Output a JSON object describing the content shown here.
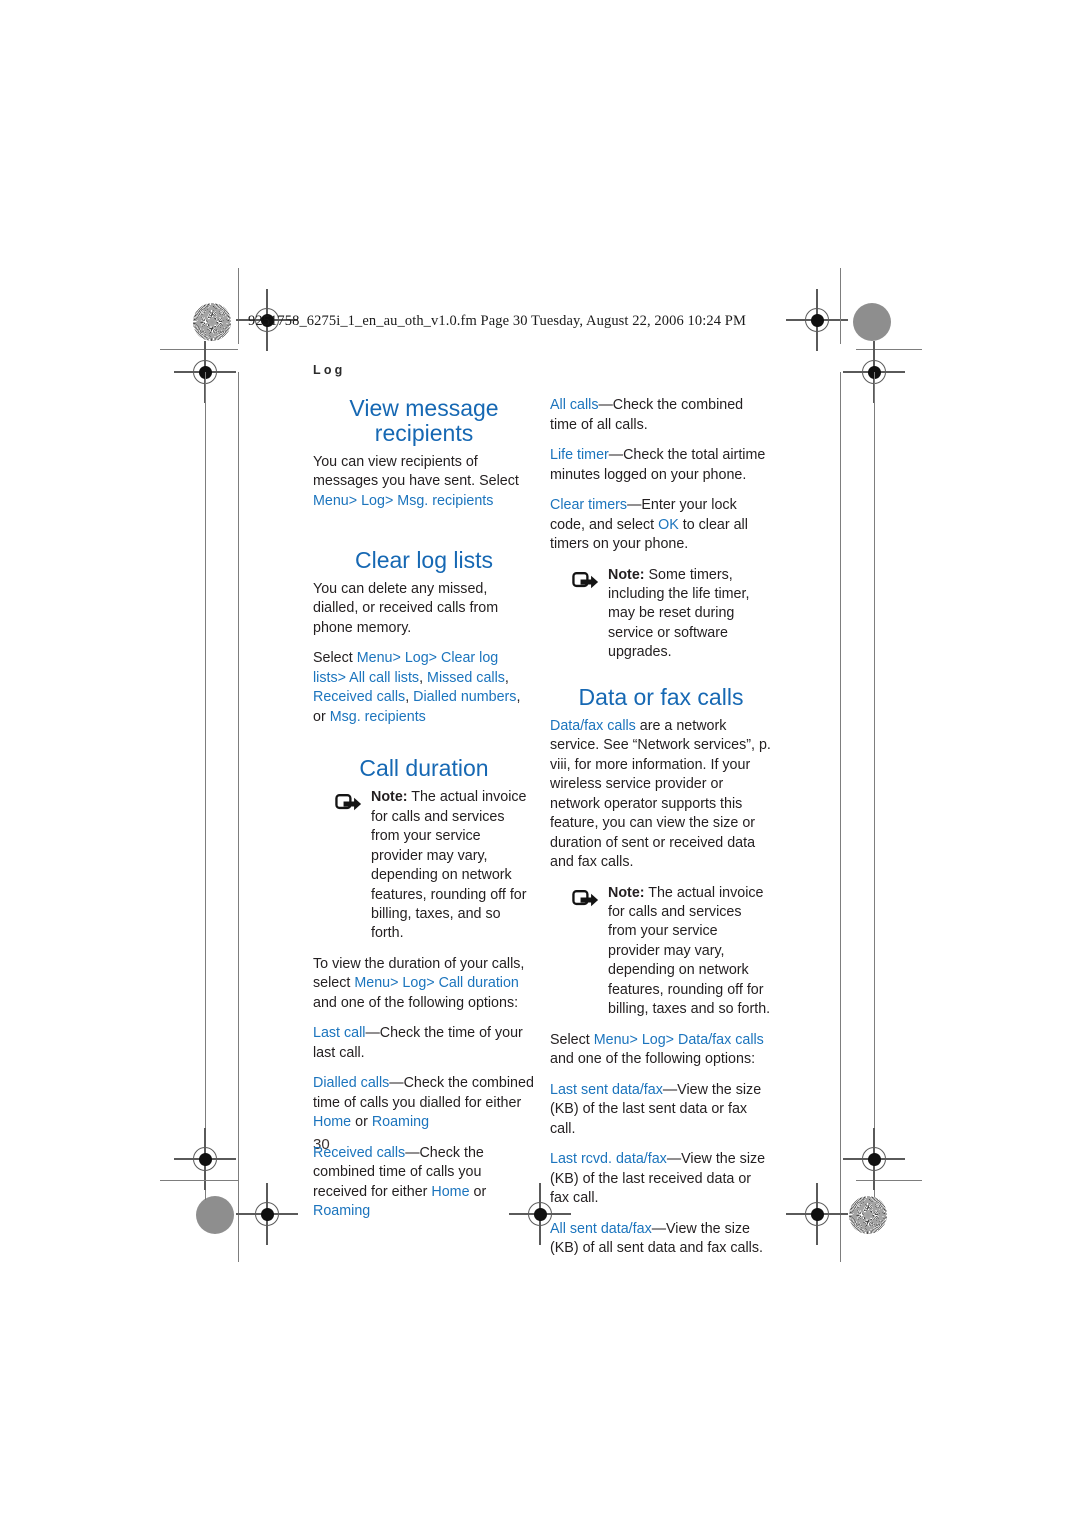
{
  "document": {
    "slugline": "9251758_6275i_1_en_au_oth_v1.0.fm  Page 30  Tuesday, August 22, 2006  10:24 PM",
    "running_head": "Log",
    "page_number": "30",
    "accent_color": "#1668b3",
    "link_color": "#1b74bd",
    "text_color": "#231f20"
  },
  "marks": {
    "starburst_top_left": "starburst-print-mark",
    "gray_circle_top_right": "gray-circle-print-mark",
    "gray_circle_bottom_left": "gray-circle-print-mark",
    "starburst_bottom_right": "starburst-print-mark"
  },
  "left_column": {
    "heading_view_message_recipients": "View message recipients",
    "p_view_1_a": "You can view recipients of messages you have sent. Select ",
    "p_view_1_menu": "Menu",
    "p_view_1_gt1": "> ",
    "p_view_1_log": "Log",
    "p_view_1_gt2": "> ",
    "p_view_1_msgrecip": "Msg. recipients",
    "heading_clear_log_lists": "Clear log lists",
    "p_clear_1": "You can delete any missed, dialled, or received calls from phone memory.",
    "p_clear_2_select": "Select ",
    "p_clear_2_menu": "Menu",
    "p_clear_2_gt1": "> ",
    "p_clear_2_log": "Log",
    "p_clear_2_gt2": "> ",
    "p_clear_2_clearloglists": "Clear log lists",
    "p_clear_2_gt3": "> ",
    "p_clear_2_allcalllists": "All call lists",
    "p_clear_2_c1": ", ",
    "p_clear_2_missedcalls": "Missed calls",
    "p_clear_2_c2": ", ",
    "p_clear_2_receivedcalls": "Received calls",
    "p_clear_2_c3": ", ",
    "p_clear_2_diallednumbers": "Dialled numbers",
    "p_clear_2_or": ", or ",
    "p_clear_2_msgrecipients": "Msg. recipients",
    "heading_call_duration": "Call duration",
    "note1_label": "Note:",
    "note1_text": " The actual invoice for calls and services from your service provider may vary, depending on network features, rounding off for billing, taxes, and so forth.",
    "p_dur_1_a": "To view the duration of your calls, select ",
    "p_dur_1_menu": "Menu",
    "p_dur_1_gt1": "> ",
    "p_dur_1_log": "Log",
    "p_dur_1_gt2": "> ",
    "p_dur_1_callduration": "Call duration",
    "p_dur_1_b": " and one of the following options:",
    "opt_lastcall_term": "Last call",
    "opt_lastcall_def": "—Check the time of your last call.",
    "opt_dialledcalls_term": "Dialled calls",
    "opt_dialledcalls_def_a": "—Check the combined time of calls you dialled for either ",
    "opt_dialledcalls_home": "Home",
    "opt_dialledcalls_or": " or ",
    "opt_dialledcalls_roaming": "Roaming",
    "opt_receivedcalls_term": "Received calls",
    "opt_receivedcalls_def_a": "—Check the combined time of calls you received for either ",
    "opt_receivedcalls_home": "Home",
    "opt_receivedcalls_or": " or ",
    "opt_receivedcalls_roaming": "Roaming"
  },
  "right_column": {
    "opt_allcalls_term": "All calls",
    "opt_allcalls_def": "—Check the combined time of all calls.",
    "opt_lifetimer_term": "Life timer",
    "opt_lifetimer_def": "—Check the total airtime minutes logged on your phone.",
    "opt_cleartimers_term": "Clear timers",
    "opt_cleartimers_def_a": "—Enter your lock code, and select ",
    "opt_cleartimers_ok": "OK",
    "opt_cleartimers_def_b": " to clear all timers on your phone.",
    "note2_label": "Note:",
    "note2_text": " Some timers, including the life timer, may be reset during service or software upgrades.",
    "heading_data_or_fax_calls": "Data or fax calls",
    "p_data_1_term": "Data/fax calls",
    "p_data_1_text": " are a network service. See “Network services”, p. viii, for more information. If your wireless service provider or network operator supports this feature, you can view the size or duration of sent or received data and fax calls.",
    "note3_label": "Note:",
    "note3_text": " The actual invoice for calls and services from your service provider may vary, depending on network features, rounding off for billing, taxes and so forth.",
    "p_sel_select": "Select ",
    "p_sel_menu": "Menu",
    "p_sel_gt1": "> ",
    "p_sel_log": "Log",
    "p_sel_gt2": "> ",
    "p_sel_datafaxcalls": "Data/fax calls",
    "p_sel_tail": " and one of the following options:",
    "opt_lastsent_term": "Last sent data/fax",
    "opt_lastsent_def": "—View the size (KB) of the last sent data or fax call.",
    "opt_lastrcvd_term": "Last rcvd. data/fax",
    "opt_lastrcvd_def": "—View the size (KB) of the last received data or fax call.",
    "opt_allsent_term": "All sent data/fax",
    "opt_allsent_def": "—View the size (KB) of all sent data and fax calls."
  }
}
